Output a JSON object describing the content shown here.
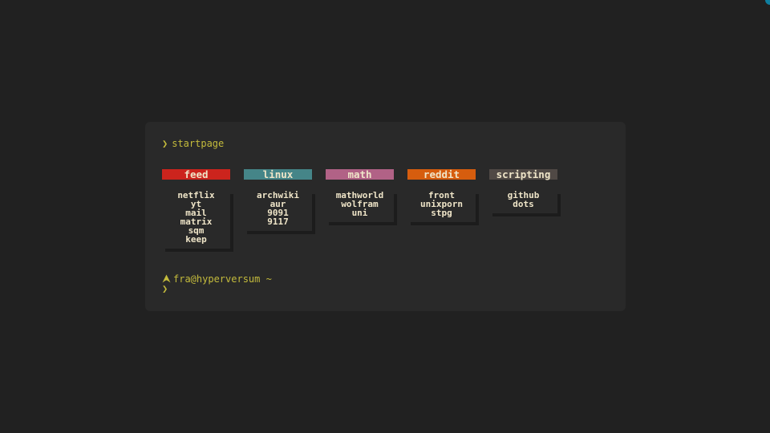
{
  "page": {
    "background": "#212121",
    "terminal_background": "#292929",
    "text_color": "#efe5c8",
    "prompt_color": "#c4bb3c"
  },
  "prompt": {
    "symbol": "❯",
    "command": "startpage"
  },
  "columns": [
    {
      "title": "feed",
      "color": "#cc241d",
      "links": [
        "netflix",
        "yt",
        "mail",
        "matrix",
        "sqm",
        "keep"
      ]
    },
    {
      "title": "linux",
      "color": "#458588",
      "links": [
        "archwiki",
        "aur",
        "9091",
        "9117"
      ]
    },
    {
      "title": "math",
      "color": "#b16286",
      "links": [
        "mathworld",
        "wolfram",
        "uni"
      ]
    },
    {
      "title": "reddit",
      "color": "#d65d0e",
      "links": [
        "front",
        "unixporn",
        "stpg"
      ]
    },
    {
      "title": "scripting",
      "color": "#504945",
      "links": [
        "github",
        "dots"
      ]
    }
  ],
  "shell": {
    "icon": "arch-linux-icon",
    "user_host": "fra@hyperversum ~",
    "input_symbol": "❯"
  }
}
